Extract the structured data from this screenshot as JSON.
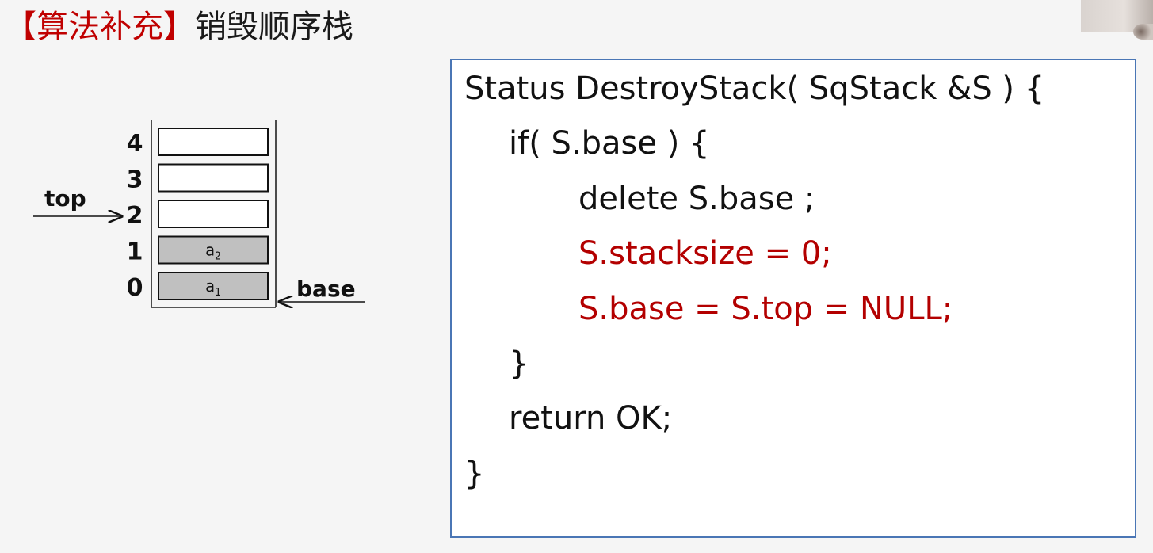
{
  "header": {
    "title_bracket": "【算法补充】",
    "title_text": "销毁顺序栈"
  },
  "stack_diagram": {
    "indices": [
      "4",
      "3",
      "2",
      "1",
      "0"
    ],
    "cells": [
      {
        "index": "4",
        "value": "",
        "filled": false
      },
      {
        "index": "3",
        "value": "",
        "filled": false
      },
      {
        "index": "2",
        "value": "",
        "filled": false
      },
      {
        "index": "1",
        "value": "a",
        "sub": "2",
        "filled": true
      },
      {
        "index": "0",
        "value": "a",
        "sub": "1",
        "filled": true
      }
    ],
    "top_label": "top",
    "base_label": "base",
    "top_points_to": "2",
    "base_points_to": "0"
  },
  "code": {
    "lines": [
      {
        "text": "Status DestroyStack( SqStack &S ) {",
        "indent": 0,
        "highlight": false
      },
      {
        "text": "if( S.base ) {",
        "indent": 1,
        "highlight": false
      },
      {
        "text": "delete S.base ;",
        "indent": 2,
        "highlight": false
      },
      {
        "text": "S.stacksize = 0;",
        "indent": 2,
        "highlight": true
      },
      {
        "text": "S.base = S.top = NULL;",
        "indent": 2,
        "highlight": true
      },
      {
        "text": "}",
        "indent": 1,
        "highlight": false
      },
      {
        "text": "return OK;",
        "indent": 1,
        "highlight": false
      },
      {
        "text": "}",
        "indent": 0,
        "highlight": false
      }
    ]
  },
  "colors": {
    "highlight": "#b30000",
    "box_border": "#4a76b5",
    "filled_cell": "#c0c0c0"
  }
}
